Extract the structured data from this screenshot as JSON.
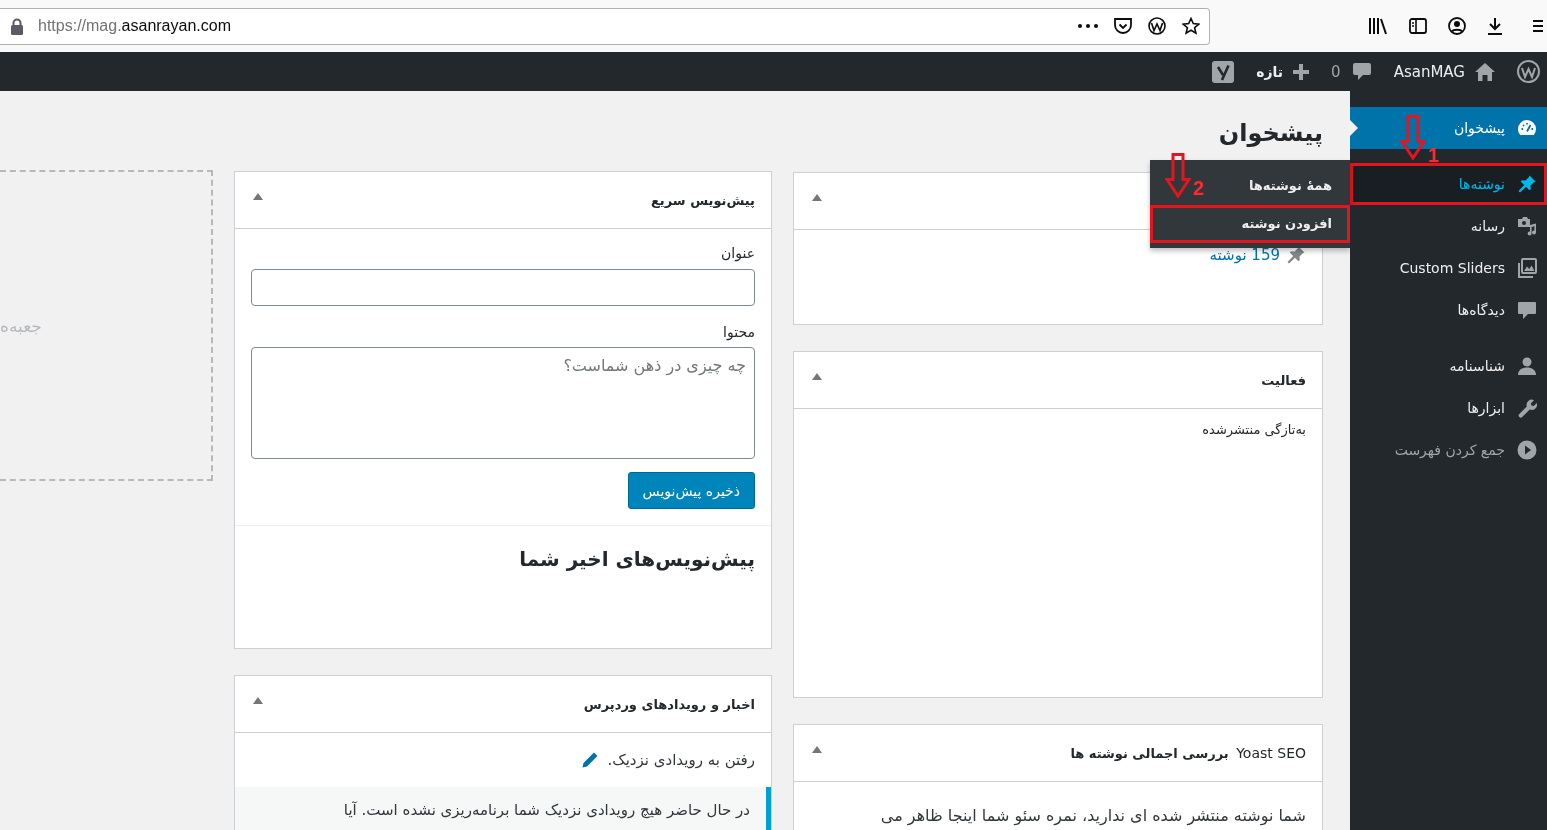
{
  "browser": {
    "url": {
      "dim": "https://mag.",
      "main": "asanrayan.com"
    }
  },
  "admin_bar": {
    "site_name": "AsanMAG",
    "comments_count": "0",
    "new_label": "تازه"
  },
  "sidebar": {
    "groups": [
      {
        "items": [
          {
            "kind": "menu",
            "label": "پیشخوان",
            "selected": true,
            "hovered": false,
            "highlighted": false
          }
        ]
      },
      {
        "items": [
          {
            "kind": "menu",
            "label": "نوشته‌ها",
            "selected": false,
            "hovered": true,
            "highlighted": true,
            "callout": "1",
            "submenu": [
              {
                "label": "همهٔ نوشته‌ها",
                "highlighted": false
              },
              {
                "label": "افزودن نوشته",
                "highlighted": true,
                "callout": "2"
              }
            ]
          },
          {
            "kind": "menu",
            "label": "رسانه",
            "selected": false,
            "hovered": false,
            "highlighted": false
          },
          {
            "kind": "menu",
            "label": "Custom Sliders",
            "selected": false,
            "hovered": false,
            "highlighted": false
          },
          {
            "kind": "menu",
            "label": "دیدگاه‌ها",
            "selected": false,
            "hovered": false,
            "highlighted": false
          }
        ]
      },
      {
        "items": [
          {
            "kind": "menu",
            "label": "شناسنامه",
            "selected": false,
            "hovered": false,
            "highlighted": false
          },
          {
            "kind": "menu",
            "label": "ابزارها",
            "selected": false,
            "hovered": false,
            "highlighted": false
          },
          {
            "kind": "collapse",
            "label": "جمع کردن فهرست",
            "selected": false,
            "hovered": false,
            "highlighted": false
          }
        ]
      }
    ]
  },
  "page_title": "پیشخوان",
  "columns": [
    {
      "cards": [
        {
          "kind": "glance",
          "expanded": true,
          "items": [
            "159 نوشته"
          ]
        },
        {
          "kind": "activity",
          "title": "فعالیت",
          "expanded": true,
          "subheading": "به‌تازگی منتشرشده"
        },
        {
          "kind": "text",
          "title_prefix": "Yoast SEO",
          "title": "بررسی اجمالی نوشته ها",
          "expanded": true,
          "body": "شما نوشته منتشر شده ای ندارید، نمره سئو شما اینجا ظاهر می"
        }
      ]
    },
    {
      "cards": [
        {
          "kind": "quick_draft",
          "title": "پیش‌نویس سریع",
          "expanded": true,
          "fields": [
            {
              "kind": "input",
              "label": "عنوان"
            },
            {
              "kind": "textarea",
              "label": "محتوا",
              "placeholder": "چه چیزی در ذهن شماست؟"
            }
          ],
          "button": "ذخیره پیش‌نویس",
          "recent_heading": "پیش‌نویس‌های اخیر شما"
        },
        {
          "kind": "news",
          "title": "اخبار و رویدادهای وردپرس",
          "expanded": true,
          "link": "رفتن به رویدادی نزدیک.",
          "notice": "در حال حاضر هیچ رویدادی نزدیک شما برنامه‌ریزی نشده است. آیا"
        }
      ]
    }
  ],
  "drop_zone": {
    "label": "جعبه‌ه"
  }
}
